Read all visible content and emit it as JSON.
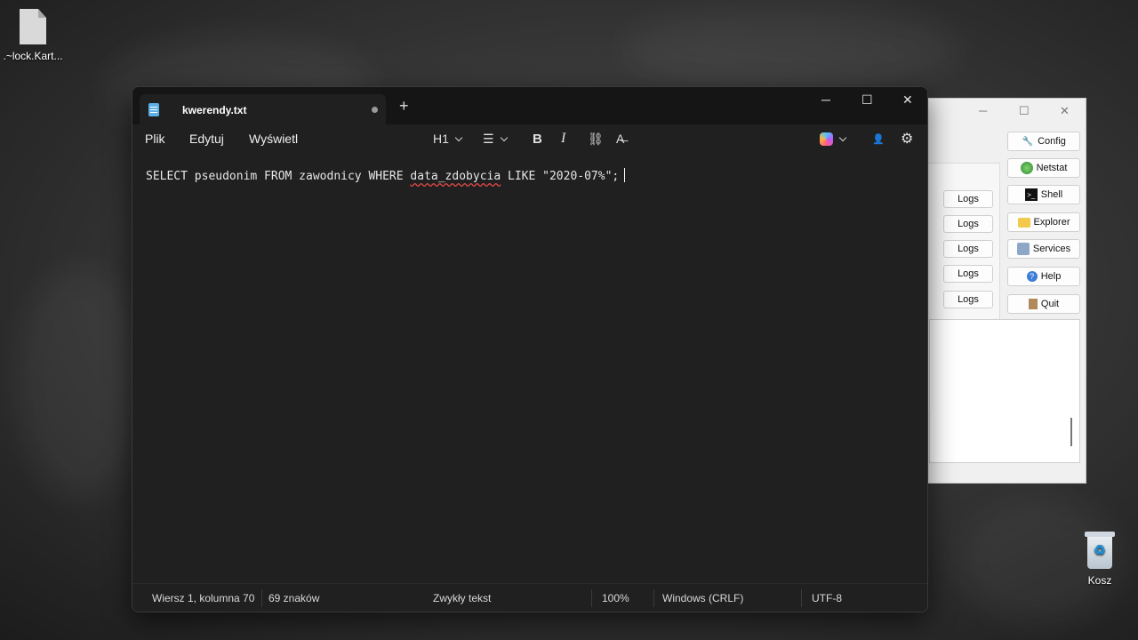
{
  "desktop": {
    "file_icon_label": ".~lock.Kart...",
    "recycle_bin_label": "Kosz"
  },
  "notepad": {
    "tab_title": "kwerendy.txt",
    "new_tab_symbol": "+",
    "controls": {
      "minimize": "─",
      "maximize": "☐",
      "close": "✕"
    },
    "menu": [
      "Plik",
      "Edytuj",
      "Wyświetl"
    ],
    "toolbar": {
      "heading": "H1",
      "list_symbol": "☰",
      "bold": "B",
      "italic": "I",
      "link_symbol": "⛓",
      "clear_format": "A̶",
      "user_symbol": "👤",
      "settings_symbol": "⚙"
    },
    "content": {
      "before": "SELECT pseudonim FROM zawodnicy WHERE ",
      "misspelled": "data_zdobycia",
      "after": " LIKE \"2020-07%\";"
    },
    "status": {
      "position": "Wiersz 1, kolumna 70",
      "chars": "69 znaków",
      "format": "Zwykły tekst",
      "zoom": "100%",
      "line_ending": "Windows (CRLF)",
      "encoding": "UTF-8"
    }
  },
  "background_app": {
    "controls": {
      "minimize": "─",
      "maximize": "☐",
      "close": "✕"
    },
    "logs_label": "Logs",
    "buttons": [
      {
        "label": "Config",
        "icon": "wrench-icon"
      },
      {
        "label": "Netstat",
        "icon": "globe-icon"
      },
      {
        "label": "Shell",
        "icon": "terminal-icon"
      },
      {
        "label": "Explorer",
        "icon": "folder-icon"
      },
      {
        "label": "Services",
        "icon": "services-icon"
      },
      {
        "label": "Help",
        "icon": "help-icon"
      },
      {
        "label": "Quit",
        "icon": "quit-icon"
      }
    ]
  }
}
